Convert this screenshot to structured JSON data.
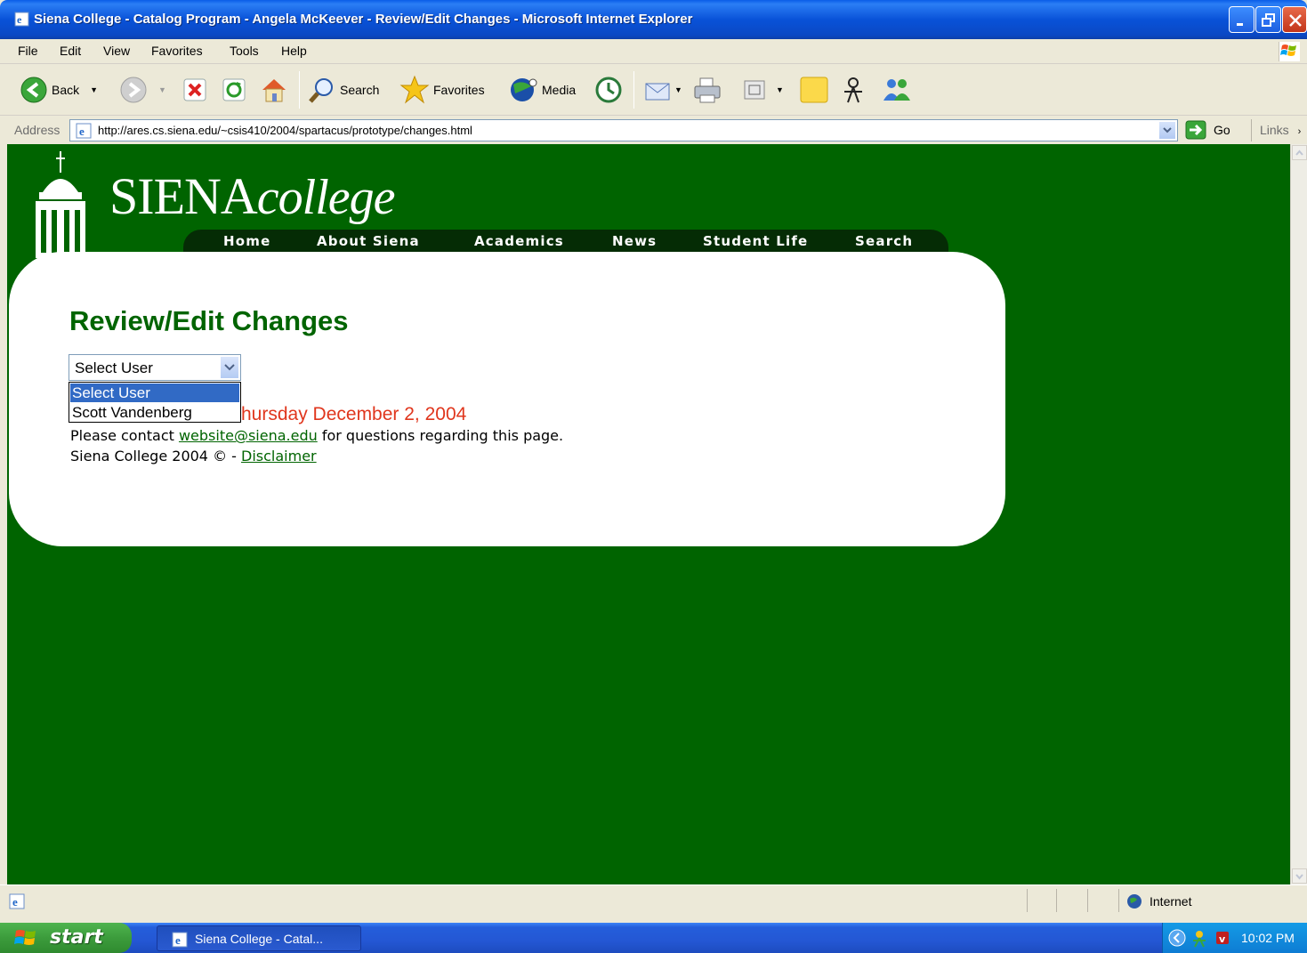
{
  "window": {
    "title": "Siena College - Catalog Program - Angela McKeever - Review/Edit Changes - Microsoft Internet Explorer"
  },
  "menu": {
    "items": [
      "File",
      "Edit",
      "View",
      "Favorites",
      "Tools",
      "Help"
    ]
  },
  "toolbar": {
    "back_label": "Back",
    "search_label": "Search",
    "favorites_label": "Favorites",
    "media_label": "Media"
  },
  "address": {
    "label": "Address",
    "url": "http://ares.cs.siena.edu/~csis410/2004/spartacus/prototype/changes.html",
    "go_label": "Go",
    "links_label": "Links"
  },
  "site": {
    "logo_siena": "SIENA",
    "logo_college": "college",
    "nav": [
      "Home",
      "About Siena",
      "Academics",
      "News",
      "Student Life",
      "Search"
    ]
  },
  "page": {
    "heading": "Review/Edit Changes",
    "select_value": "Select User",
    "options": [
      "Select User",
      "Scott Vandenberg"
    ],
    "date_text": "hursday December 2, 2004",
    "contact_prefix": "Please contact ",
    "contact_email": "website@siena.edu",
    "contact_suffix": " for questions regarding this page.",
    "copyright": "Siena College 2004 © - ",
    "disclaimer": "Disclaimer"
  },
  "status": {
    "zone": "Internet"
  },
  "taskbar": {
    "start": "start",
    "task_label": "Siena College - Catal...",
    "clock": "10:02 PM"
  },
  "colors": {
    "page_bg": "#006400",
    "heading": "#006400",
    "date": "#e0361d",
    "nav_bg": "#052c05"
  }
}
